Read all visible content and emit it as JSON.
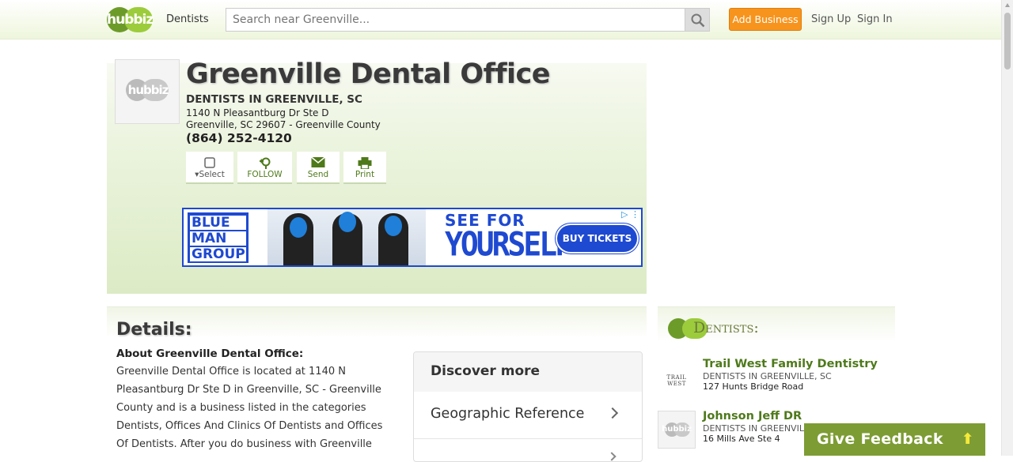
{
  "nav": {
    "logo_text": "hubbiz",
    "category_link": "Dentists",
    "search_placeholder": "Search near Greenville...",
    "add_business": "Add Business",
    "sign_up": "Sign Up",
    "sign_in": "Sign In"
  },
  "business": {
    "logo_text": "hubbiz",
    "name": "Greenville Dental Office",
    "category": "DENTISTS IN GREENVILLE, SC",
    "address_line1": "1140 N Pleasantburg Dr Ste D",
    "address_line2": "Greenville, SC 29607 - Greenville County",
    "phone": "(864) 252-4120",
    "actions": [
      {
        "label": "Select",
        "icon": "checkbox-icon"
      },
      {
        "label": "FOLLOW",
        "icon": "follow-pin-icon"
      },
      {
        "label": "Send",
        "icon": "envelope-icon"
      },
      {
        "label": "Print",
        "icon": "printer-icon"
      }
    ]
  },
  "ad": {
    "brand_line1": "BLUE",
    "brand_line2": "MAN",
    "brand_line3": "GROUP",
    "headline1": "SEE FOR",
    "headline2": "YOURSELF",
    "cta": "BUY TICKETS"
  },
  "details": {
    "title": "Details:",
    "about_title": "About Greenville Dental Office:",
    "about_text": "Greenville Dental Office is located at 1140 N Pleasantburg Dr Ste D in Greenville, SC - Greenville County and is a business listed in the categories Dentists, Offices And Clinics Of Dentists and Offices Of Dentists. After you do business with Greenville"
  },
  "discover": {
    "title": "Discover more",
    "items": [
      "Geographic Reference"
    ]
  },
  "sidebar": {
    "title": "Dentists:",
    "items": [
      {
        "logo_text": "TRAIL WEST",
        "name": "Trail West Family Dentistry",
        "category": "DENTISTS IN GREENVILLE, SC",
        "address": "127 Hunts Bridge Road"
      },
      {
        "logo_text": "hubbiz",
        "name": "Johnson Jeff DR",
        "category": "DENTISTS IN GREENVILLE, SC",
        "address": "16 Mills Ave Ste 4"
      }
    ]
  },
  "feedback": {
    "label": "Give Feedback",
    "arrow": "⬆"
  },
  "colors": {
    "brand_green": "#6d9b2a",
    "accent_orange": "#f7941d",
    "link_green": "#4e7a1a",
    "feedback_green": "#7d9c34",
    "ad_blue": "#1e49d1"
  }
}
